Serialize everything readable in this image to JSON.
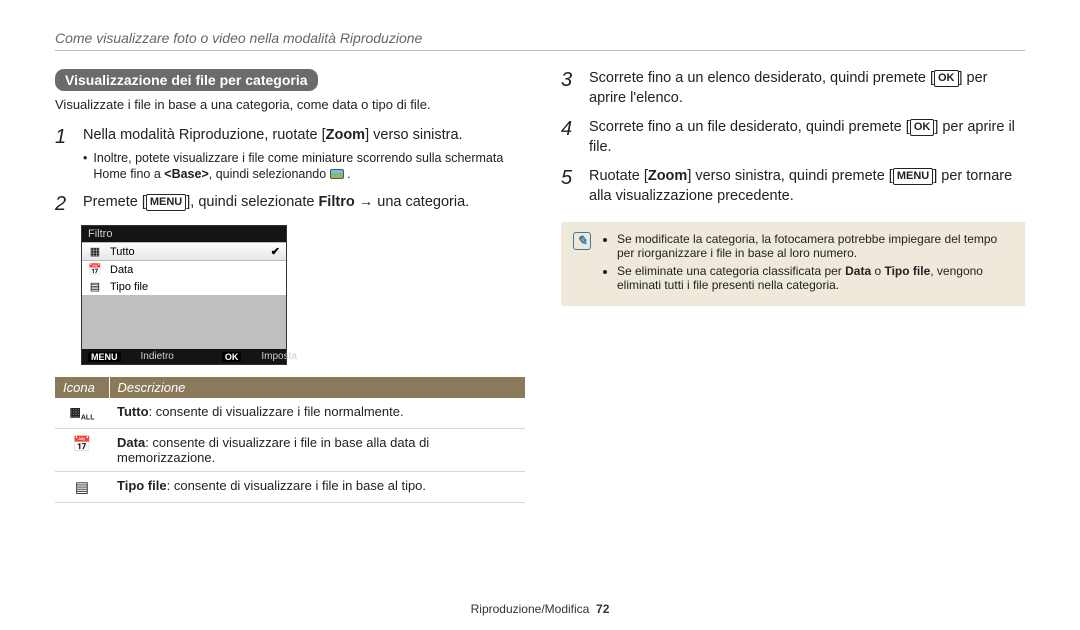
{
  "breadcrumb": "Come visualizzare foto o video nella modalità Riproduzione",
  "sectionTitle": "Visualizzazione dei file per categoria",
  "sectionDesc": "Visualizzate i file in base a una categoria, come data o tipo di file.",
  "steps": {
    "1": {
      "text_a": "Nella modalità Riproduzione, ruotate [",
      "zoom": "Zoom",
      "text_b": "] verso sinistra.",
      "sub_a": "Inoltre, potete visualizzare i file come miniature scorrendo sulla schermata Home fino a ",
      "sub_b": "<Base>",
      "sub_c": ", quindi selezionando ",
      "sub_end": " ."
    },
    "2": {
      "text_a": "Premete [",
      "menu": "MENU",
      "text_b": "], quindi selezionate ",
      "bold": "Filtro",
      "text_c": " → una categoria."
    },
    "3": {
      "text_a": "Scorrete fino a un elenco desiderato, quindi premete [",
      "ok": "OK",
      "text_b": "] per aprire l'elenco."
    },
    "4": {
      "text_a": "Scorrete fino a un file desiderato, quindi premete [",
      "ok": "OK",
      "text_b": "] per aprire il file."
    },
    "5": {
      "text_a": "Ruotate [",
      "zoom": "Zoom",
      "text_b": "] verso sinistra, quindi premete [",
      "menu": "MENU",
      "text_c": "] per tornare alla visualizzazione precedente."
    }
  },
  "filterPanel": {
    "title": "Filtro",
    "items": [
      "Tutto",
      "Data",
      "Tipo file"
    ],
    "back": "Indietro",
    "set": "Imposta",
    "menuTag": "MENU",
    "okTag": "OK"
  },
  "table": {
    "head_icon": "Icona",
    "head_desc": "Descrizione",
    "rows": {
      "0": {
        "bold": "Tutto",
        "rest": ": consente di visualizzare i file normalmente."
      },
      "1": {
        "bold": "Data",
        "rest": ": consente di visualizzare i file in base alla data di memorizzazione."
      },
      "2": {
        "bold": "Tipo file",
        "rest": ": consente di visualizzare i file in base al tipo."
      }
    }
  },
  "note": {
    "0": {
      "a": "Se modificate la categoria, la fotocamera potrebbe impiegare del tempo per riorganizzare i file in base al loro numero."
    },
    "1": {
      "a": "Se eliminate una categoria classificata per ",
      "b1": "Data",
      "mid": " o ",
      "b2": "Tipo file",
      "c": ", vengono eliminati tutti i file presenti nella categoria."
    }
  },
  "footer": {
    "section": "Riproduzione/Modifica",
    "page": "72"
  }
}
